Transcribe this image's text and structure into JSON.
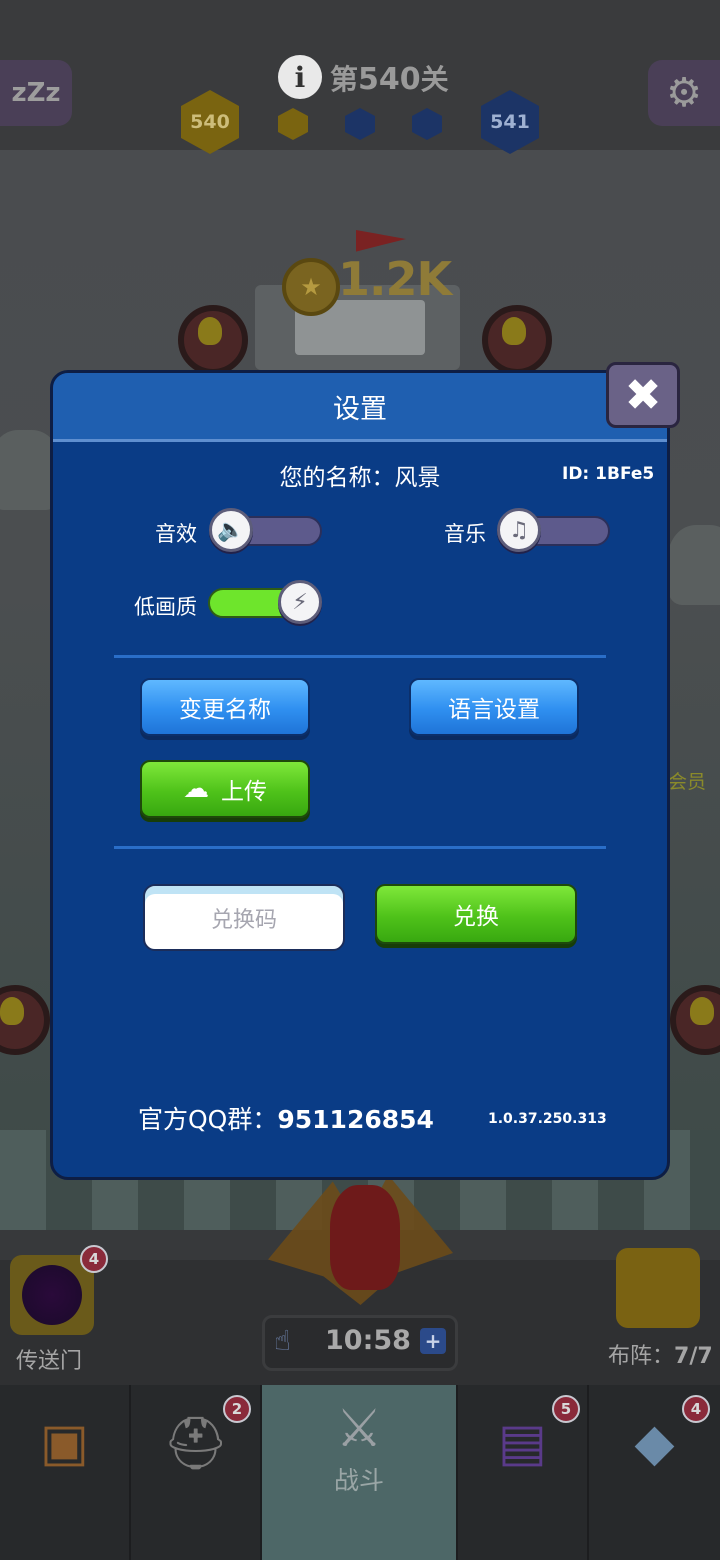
{
  "hud": {
    "sleep_label": "zZz",
    "level_prefix": "第",
    "level_number": "540",
    "level_suffix": "关",
    "current_level": "540",
    "next_level": "541",
    "coins": "1.2K"
  },
  "dialog": {
    "title": "设置",
    "name_label": "您的名称：风景",
    "id_label": "ID: 1BFe5",
    "sound_label": "音效",
    "music_label": "音乐",
    "low_quality_label": "低画质",
    "sound_on": false,
    "music_on": false,
    "low_quality_on": true,
    "rename_button": "变更名称",
    "language_button": "语言设置",
    "upload_button": "上传",
    "code_placeholder": "兑换码",
    "redeem_button": "兑换",
    "qq_prefix": "官方QQ群：",
    "qq_number": "951126854",
    "version": "1.0.37.250.313"
  },
  "side": {
    "portal_label": "传送门",
    "portal_badge": "4",
    "formation_label": "布阵：",
    "formation_value": "7/7",
    "vip_label": "会员",
    "timer": "10:58"
  },
  "tabs": [
    {
      "icon": "treasure-chest-icon",
      "badge": ""
    },
    {
      "icon": "viking-helmet-icon",
      "badge": "2"
    },
    {
      "icon": "crossed-swords-icon",
      "label": "战斗",
      "active": true
    },
    {
      "icon": "spellbook-icon",
      "badge": "5"
    },
    {
      "icon": "amulet-icon",
      "badge": "4"
    }
  ],
  "colors": {
    "dialog_bg": "#0a3c86",
    "dialog_header": "#1f5fb0",
    "button_blue": "#2f8ff0",
    "button_green": "#4fc21a",
    "toggle_on": "#6ee52c",
    "toggle_off": "#5d5a8c"
  }
}
